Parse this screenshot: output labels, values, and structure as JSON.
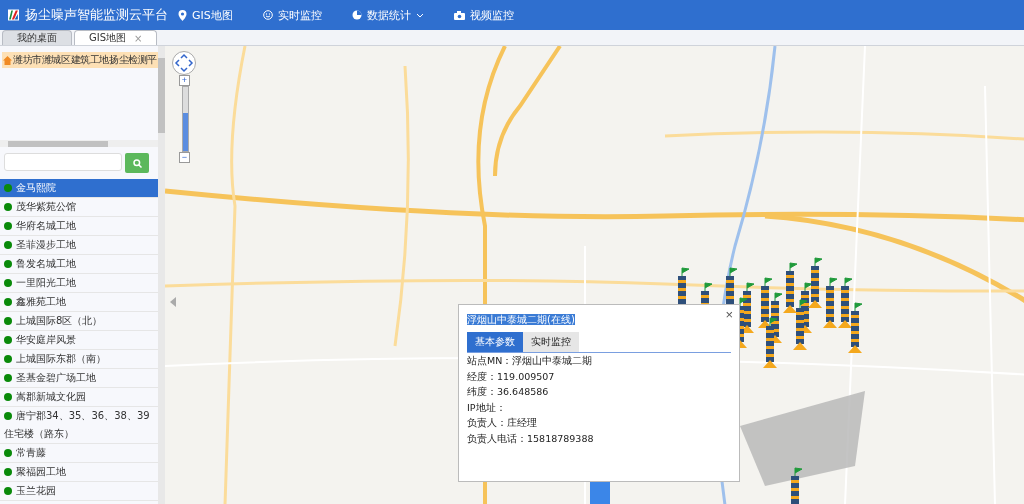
{
  "header": {
    "title": "扬尘噪声智能监测云平台",
    "nav": [
      {
        "kind": "pin",
        "label": "GIS地图",
        "dropdown": false
      },
      {
        "kind": "face",
        "label": "实时监控",
        "dropdown": false
      },
      {
        "kind": "chart",
        "label": "数据统计",
        "dropdown": true
      },
      {
        "kind": "camera",
        "label": "视频监控",
        "dropdown": false
      }
    ]
  },
  "tabs": [
    {
      "label": "我的桌面",
      "selected": false
    },
    {
      "label": "GIS地图",
      "selected": true,
      "close": "×"
    }
  ],
  "sidebar": {
    "tree_root": "潍坊市潍城区建筑工地扬尘检测平",
    "sites": [
      {
        "name": "金马熙院",
        "selected": true,
        "color": "#0a8a0a"
      },
      {
        "name": "茂华紫苑公馆",
        "selected": false,
        "color": "#0a8a0a"
      },
      {
        "name": "华府名城工地",
        "selected": false,
        "color": "#0a8a0a"
      },
      {
        "name": "圣菲漫步工地",
        "selected": false,
        "color": "#0a8a0a"
      },
      {
        "name": "鲁发名城工地",
        "selected": false,
        "color": "#0a8a0a"
      },
      {
        "name": "一里阳光工地",
        "selected": false,
        "color": "#0a8a0a"
      },
      {
        "name": "鑫雅苑工地",
        "selected": false,
        "color": "#0a8a0a"
      },
      {
        "name": "上城国际8区（北）",
        "selected": false,
        "color": "#0a8a0a"
      },
      {
        "name": "华安庭岸风景",
        "selected": false,
        "color": "#0a8a0a"
      },
      {
        "name": "上城国际东郡（南）",
        "selected": false,
        "color": "#0a8a0a"
      },
      {
        "name": "圣基金碧广场工地",
        "selected": false,
        "color": "#0a8a0a"
      },
      {
        "name": "嵩郡新城文化园",
        "selected": false,
        "color": "#0a8a0a"
      },
      {
        "name": "唐宁郡34、35、36、38、39住宅楼（路东）",
        "selected": false,
        "color": "#0a8a0a"
      },
      {
        "name": "常青藤",
        "selected": false,
        "color": "#0a8a0a"
      },
      {
        "name": "聚福园工地",
        "selected": false,
        "color": "#0a8a0a"
      },
      {
        "name": "玉兰花园",
        "selected": false,
        "color": "#0a8a0a"
      }
    ]
  },
  "map": {
    "zoom": {
      "in": "+",
      "out": "−",
      "level": 0.6
    },
    "popup": {
      "title": "浮烟山中泰城二期(在线)",
      "close": "×",
      "tabs": [
        {
          "label": "基本参数",
          "selected": true
        },
        {
          "label": "实时监控",
          "selected": false
        }
      ],
      "fields": [
        "站点MN：浮烟山中泰城二期",
        "经度：119.009507",
        "纬度：36.648586",
        "IP地址：",
        "负责人：庄经理",
        "负责人电话：15818789388"
      ]
    }
  }
}
